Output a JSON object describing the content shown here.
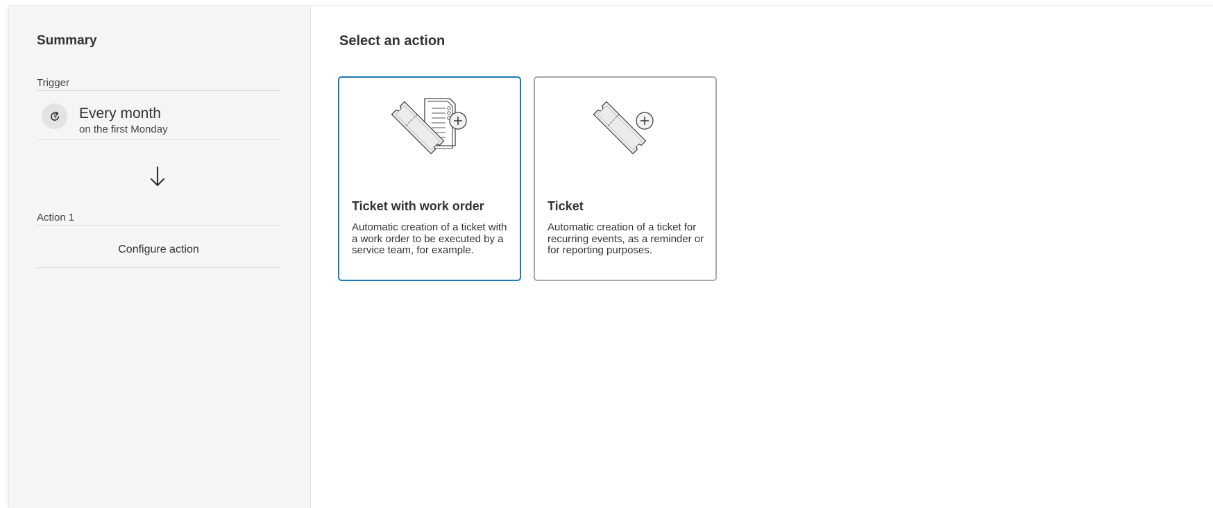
{
  "sidebar": {
    "title": "Summary",
    "trigger": {
      "label": "Trigger",
      "title": "Every month",
      "subtitle": "on the first Monday",
      "icon": "recurring-icon"
    },
    "arrow_icon": "arrow-down-icon",
    "action": {
      "label": "Action 1",
      "configure_label": "Configure action"
    }
  },
  "main": {
    "title": "Select an action",
    "options": [
      {
        "title": "Ticket with work order",
        "description": "Automatic creation of a ticket with a work order to be executed by a service team, for example.",
        "icon": "ticket-work-order-icon",
        "selected": true
      },
      {
        "title": "Ticket",
        "description": "Automatic creation of a ticket for recurring events, as a reminder or for reporting purposes.",
        "icon": "ticket-icon",
        "selected": false
      }
    ]
  },
  "colors": {
    "sidebar_bg": "#f5f5f5",
    "selected_border": "#1b79b4",
    "card_border": "#a9a9a9",
    "text": "#333333"
  }
}
